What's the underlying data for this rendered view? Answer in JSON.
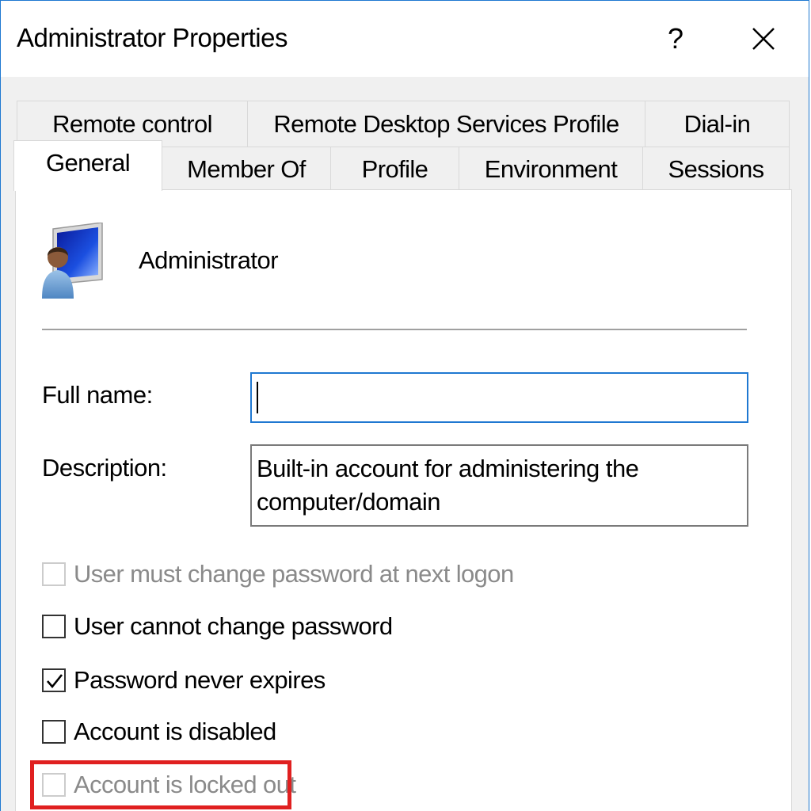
{
  "window": {
    "title": "Administrator Properties",
    "help_label": "?",
    "accent_color": "#1f78d1"
  },
  "tabs_row1": [
    {
      "label": "Remote control"
    },
    {
      "label": "Remote Desktop Services Profile"
    },
    {
      "label": "Dial-in"
    }
  ],
  "tabs_row2": [
    {
      "label": "General",
      "active": true
    },
    {
      "label": "Member Of"
    },
    {
      "label": "Profile"
    },
    {
      "label": "Environment"
    },
    {
      "label": "Sessions"
    }
  ],
  "general": {
    "icon": "user-computer-icon",
    "username": "Administrator",
    "full_name_label": "Full name:",
    "full_name_value": "",
    "description_label": "Description:",
    "description_value": "Built-in account for administering the computer/domain"
  },
  "options": [
    {
      "label": "User must change password at next logon",
      "checked": false,
      "disabled": true
    },
    {
      "label": "User cannot change password",
      "checked": false,
      "disabled": false
    },
    {
      "label": "Password never expires",
      "checked": true,
      "disabled": false
    },
    {
      "label": "Account is disabled",
      "checked": false,
      "disabled": false
    },
    {
      "label": "Account is locked out",
      "checked": false,
      "disabled": true,
      "highlighted": true,
      "highlight_color": "#e02020"
    }
  ]
}
